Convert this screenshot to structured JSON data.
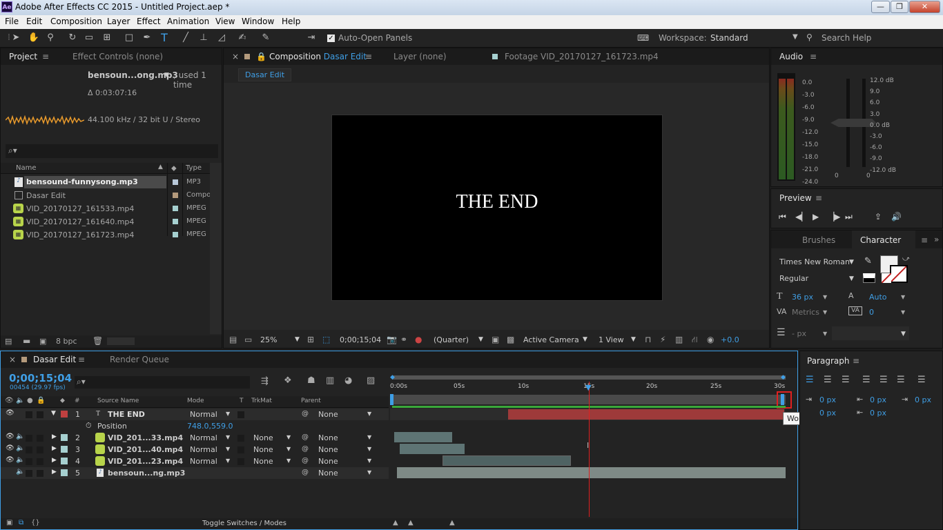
{
  "window": {
    "title": "Adobe After Effects CC 2015 - Untitled Project.aep *",
    "app_icon": "Ae",
    "controls": [
      "—",
      "❐",
      "✕"
    ]
  },
  "menu": [
    "File",
    "Edit",
    "Composition",
    "Layer",
    "Effect",
    "Animation",
    "View",
    "Window",
    "Help"
  ],
  "toolbar": {
    "auto_open_label": "Auto-Open Panels",
    "workspace_label": "Workspace:",
    "workspace_value": "Standard",
    "search_label": "Search Help"
  },
  "project": {
    "tab_project": "Project",
    "tab_effect": "Effect Controls (none)",
    "selected_name": "bensoun...ong.mp3",
    "used": ", used 1 time",
    "duration": "Δ 0:03:07:16",
    "audio_info": "44.100 kHz / 32 bit U / Stereo",
    "search_icon": "⌕▾",
    "columns": {
      "name": "Name",
      "type": "Type"
    },
    "items": [
      {
        "name": "bensound-funnysong.mp3",
        "type": "MP3",
        "color": "#b8c8d8",
        "icon": "audio-file-icon"
      },
      {
        "name": "Dasar Edit",
        "type": "Compo",
        "color": "#b49a7c",
        "icon": "composition-icon"
      },
      {
        "name": "VID_20170127_161533.mp4",
        "type": "MPEG",
        "color": "#a6d0d0",
        "icon": "footage-icon"
      },
      {
        "name": "VID_20170127_161640.mp4",
        "type": "MPEG",
        "color": "#a6d0d0",
        "icon": "footage-icon"
      },
      {
        "name": "VID_20170127_161723.mp4",
        "type": "MPEG",
        "color": "#a6d0d0",
        "icon": "footage-icon"
      }
    ],
    "bpc": "8 bpc"
  },
  "composition": {
    "close": "×",
    "tab_prefix": "Composition",
    "tab_name": "Dasar Edit",
    "tab_layer": "Layer (none)",
    "tab_footage": "Footage VID_20170127_161723.mp4",
    "sub_tab": "Dasar Edit",
    "viewer_text": "THE END",
    "zoom": "25%",
    "timecode": "0;00;15;04",
    "resolution": "(Quarter)",
    "camera": "Active Camera",
    "views": "1 View",
    "exposure": "+0.0"
  },
  "audio": {
    "title": "Audio",
    "left_scale": [
      "0.0",
      "-3.0",
      "-6.0",
      "-9.0",
      "-12.0",
      "-15.0",
      "-18.0",
      "-21.0",
      "-24.0"
    ],
    "right_scale": [
      "12.0 dB",
      "9.0",
      "6.0",
      "3.0",
      "0.0 dB",
      "-3.0",
      "-6.0",
      "-9.0",
      "-12.0 dB"
    ],
    "slider_values": [
      "0",
      "0"
    ]
  },
  "preview": {
    "title": "Preview"
  },
  "character": {
    "tab_brushes": "Brushes",
    "tab_character": "Character",
    "font": "Times New Roman",
    "style": "Regular",
    "size": "36 px",
    "leading": "Auto",
    "kerning": "Metrics",
    "tracking": "0",
    "stroke": "- px"
  },
  "paragraph": {
    "title": "Paragraph",
    "indent1": "0 px",
    "indent2": "0 px",
    "indent3": "0 px",
    "space1": "0 px",
    "space2": "0 px"
  },
  "timeline": {
    "tab_comp": "Dasar Edit",
    "tab_render": "Render Queue",
    "timecode": "0;00;15;04",
    "frames": "00454 (29.97 fps)",
    "columns": {
      "source": "Source Name",
      "mode": "Mode",
      "t": "T",
      "trkmat": "TrkMat",
      "parent": "Parent",
      "num": "#"
    },
    "ruler": [
      "0:00s",
      "05s",
      "10s",
      "15s",
      "20s",
      "25s",
      "30s"
    ],
    "layers": [
      {
        "num": "1",
        "name": "THE END",
        "mode": "Normal",
        "trkmat": "",
        "parent": "None",
        "color": "#c04040"
      },
      {
        "num": "2",
        "name": "VID_201...33.mp4",
        "mode": "Normal",
        "trkmat": "None",
        "parent": "None",
        "color": "#a6d0d0"
      },
      {
        "num": "3",
        "name": "VID_201...40.mp4",
        "mode": "Normal",
        "trkmat": "None",
        "parent": "None",
        "color": "#a6d0d0"
      },
      {
        "num": "4",
        "name": "VID_201...23.mp4",
        "mode": "Normal",
        "trkmat": "None",
        "parent": "None",
        "color": "#a6d0d0"
      },
      {
        "num": "5",
        "name": "bensoun...ng.mp3",
        "mode": "",
        "trkmat": "",
        "parent": "None",
        "color": "#a6d0d0"
      }
    ],
    "position_label": "Position",
    "position_value": "748.0,559.0",
    "tooltip": "Work Area End",
    "toggle_label": "Toggle Switches / Modes"
  }
}
